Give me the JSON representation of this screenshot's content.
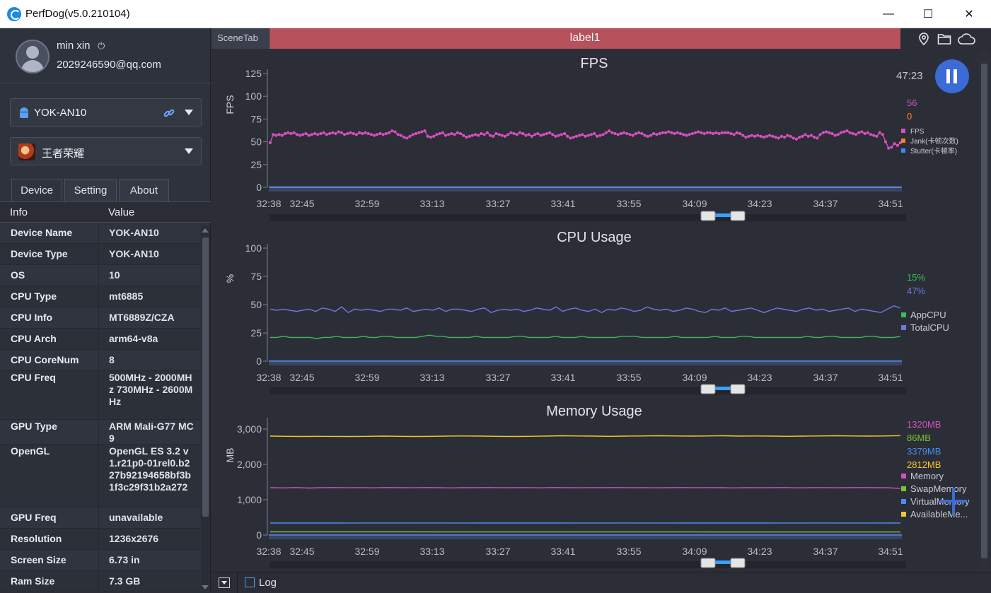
{
  "window": {
    "title": "PerfDog(v5.0.210104)",
    "minimize": "—",
    "maximize": "☐",
    "close": "✕"
  },
  "user": {
    "name": "min xin",
    "power_icon": "⏻",
    "email": "2029246590@qq.com"
  },
  "device_select": {
    "value": "YOK-AN10",
    "icon": "android-icon"
  },
  "app_select": {
    "value": "王者荣耀",
    "icon": "game-icon"
  },
  "tabs": [
    {
      "label": "Device"
    },
    {
      "label": "Setting"
    },
    {
      "label": "About"
    }
  ],
  "info_table": {
    "headers": {
      "key": "Info",
      "value": "Value"
    },
    "rows": [
      {
        "key": "Device Name",
        "value": "YOK-AN10"
      },
      {
        "key": "Device Type",
        "value": "YOK-AN10"
      },
      {
        "key": "OS",
        "value": "10"
      },
      {
        "key": "CPU Type",
        "value": "mt6885"
      },
      {
        "key": "CPU Info",
        "value": "MT6889Z/CZA"
      },
      {
        "key": "CPU Arch",
        "value": "arm64-v8a"
      },
      {
        "key": "CPU CoreNum",
        "value": "8"
      },
      {
        "key": "CPU Freq",
        "value": "500MHz - 2000MHz 730MHz - 2600MHz"
      },
      {
        "key": "GPU Type",
        "value": "ARM Mali-G77 MC9"
      },
      {
        "key": "OpenGL",
        "value": "OpenGL ES 3.2 v1.r21p0-01rel0.b227b92194658bf3b1f3c29f31b2a272"
      },
      {
        "key": "GPU Freq",
        "value": "unavailable"
      },
      {
        "key": "Resolution",
        "value": "1236x2676"
      },
      {
        "key": "Screen Size",
        "value": "6.73 in"
      },
      {
        "key": "Ram Size",
        "value": "7.3 GB"
      }
    ]
  },
  "header": {
    "scene_tab": "SceneTab",
    "label": "label1",
    "label_color": "#b5525c"
  },
  "timer": "47:23",
  "bottom": {
    "log_label": "Log"
  },
  "chart_data": [
    {
      "type": "line",
      "title": "FPS",
      "ylabel": "FPS",
      "ylim": [
        0,
        125
      ],
      "yticks": [
        "0",
        "25",
        "50",
        "75",
        "100",
        "125"
      ],
      "xticks": [
        "32:38",
        "32:45",
        "32:59",
        "33:13",
        "33:27",
        "33:41",
        "33:55",
        "34:09",
        "34:23",
        "34:37",
        "34:51"
      ],
      "current_values": [
        {
          "text": "56",
          "color": "#d64fc0"
        },
        {
          "text": "0",
          "color": "#ff7f27"
        }
      ],
      "legend": [
        {
          "name": "FPS",
          "color": "#d64fc0"
        },
        {
          "name": "Jank(卡顿次数)",
          "color": "#ff7f27"
        },
        {
          "name": "Stutter(卡顿率)",
          "color": "#3c8cf0"
        }
      ],
      "series": [
        {
          "name": "FPS",
          "color": "#d64fc0",
          "markers": true,
          "values": [
            49,
            58,
            57,
            58,
            57,
            59,
            60,
            59,
            60,
            58,
            57,
            58,
            59,
            57,
            58,
            59,
            58,
            59,
            60,
            58,
            59,
            60,
            59,
            61,
            60,
            58,
            59,
            60,
            59,
            58,
            60,
            59,
            60,
            59,
            58,
            57,
            58,
            59,
            58,
            59,
            60,
            62,
            61,
            58,
            57,
            55,
            54,
            56,
            58,
            59,
            60,
            61,
            62,
            56,
            55,
            56,
            58,
            59,
            60,
            57,
            58,
            59,
            58,
            60,
            59,
            57,
            55,
            56,
            57,
            58,
            57,
            59,
            58,
            60,
            57,
            56,
            59,
            58,
            57,
            56,
            58,
            60,
            59,
            58,
            60,
            59,
            57,
            58,
            56,
            58,
            59,
            57,
            58,
            59,
            60,
            58,
            56,
            57,
            58,
            59,
            56,
            54,
            55,
            56,
            57,
            58,
            56,
            57,
            58,
            59,
            56,
            57,
            58,
            60,
            62,
            60,
            59,
            58,
            59,
            60,
            59,
            58,
            57,
            59,
            60,
            59,
            57,
            56,
            57,
            59,
            58,
            59,
            60,
            60,
            61,
            60,
            59,
            60,
            59,
            58,
            57,
            58,
            59,
            60,
            61,
            60,
            59,
            60,
            60,
            59,
            60,
            59,
            60,
            60,
            60,
            59,
            58,
            60,
            59,
            57,
            55,
            56,
            57,
            56,
            57,
            56,
            55,
            56,
            57,
            56,
            55,
            54,
            56,
            55,
            57,
            56,
            54,
            53,
            55,
            56,
            58,
            56,
            57,
            55,
            54,
            58,
            60,
            61,
            60,
            59,
            57,
            58,
            60,
            61,
            62,
            60,
            59,
            58,
            60,
            61,
            59,
            60,
            58,
            57,
            56,
            60,
            58,
            50,
            43,
            44,
            48,
            46,
            49
          ]
        },
        {
          "name": "Jank(卡顿次数)",
          "color": "#ff7f27",
          "markers": false,
          "values": [
            0,
            0
          ]
        },
        {
          "name": "Stutter(卡顿率)",
          "color": "#3c8cf0",
          "markers": false,
          "values": [
            0,
            0
          ]
        }
      ]
    },
    {
      "type": "line",
      "title": "CPU Usage",
      "ylabel": "%",
      "ylim": [
        0,
        100
      ],
      "yticks": [
        "0",
        "25",
        "50",
        "75",
        "100"
      ],
      "xticks": [
        "32:38",
        "32:45",
        "32:59",
        "33:13",
        "33:27",
        "33:41",
        "33:55",
        "34:09",
        "34:23",
        "34:37",
        "34:51"
      ],
      "current_values": [
        {
          "text": "15%",
          "color": "#3cb95a"
        },
        {
          "text": "47%",
          "color": "#6f78e0"
        }
      ],
      "legend": [
        {
          "name": "AppCPU",
          "color": "#3cb95a"
        },
        {
          "name": "TotalCPU",
          "color": "#6f78e0"
        }
      ],
      "series": [
        {
          "name": "AppCPU",
          "color": "#3cb95a",
          "markers": false,
          "values": [
            21,
            21,
            22,
            21,
            21,
            21,
            21,
            20,
            21,
            21,
            22,
            21,
            21,
            21,
            22,
            21,
            21,
            22,
            22,
            21,
            21,
            21,
            21,
            22,
            23,
            22,
            22,
            21,
            21,
            21,
            21,
            22,
            21,
            21,
            21,
            21,
            21,
            22,
            22,
            21,
            21,
            21,
            21,
            22,
            21,
            21,
            21,
            22,
            21,
            21,
            21,
            21,
            21,
            22,
            22,
            22,
            21,
            21,
            21,
            21,
            21,
            22,
            21,
            21,
            21,
            21,
            21,
            22,
            21,
            21,
            21,
            22,
            22,
            21,
            21,
            21,
            21,
            21,
            21,
            21,
            21,
            22,
            21,
            21,
            22,
            22,
            21,
            21,
            21,
            21,
            22,
            22,
            21,
            21,
            21,
            22
          ]
        },
        {
          "name": "TotalCPU",
          "color": "#6f78e0",
          "markers": false,
          "values": [
            46,
            45,
            46,
            45,
            44,
            45,
            46,
            44,
            47,
            46,
            44,
            48,
            43,
            46,
            45,
            46,
            45,
            44,
            46,
            46,
            45,
            47,
            44,
            45,
            46,
            45,
            47,
            44,
            46,
            46,
            45,
            44,
            46,
            47,
            43,
            45,
            46,
            45,
            46,
            44,
            45,
            47,
            46,
            45,
            48,
            44,
            46,
            47,
            45,
            44,
            46,
            43,
            46,
            45,
            47,
            46,
            44,
            45,
            48,
            46,
            45,
            46,
            44,
            45,
            47,
            46,
            44,
            43,
            46,
            45,
            47,
            44,
            45,
            46,
            47,
            45,
            43,
            45,
            47,
            46,
            45,
            44,
            46,
            47,
            45,
            46,
            44,
            45,
            46,
            47,
            44,
            46,
            45,
            44,
            43,
            46,
            49,
            47
          ]
        }
      ]
    },
    {
      "type": "line",
      "title": "Memory Usage",
      "ylabel": "MB",
      "ylim": [
        0,
        3200
      ],
      "yticks": [
        "0",
        "1,000",
        "2,000",
        "3,000"
      ],
      "xticks": [
        "32:38",
        "32:45",
        "32:59",
        "33:13",
        "33:27",
        "33:41",
        "33:55",
        "34:09",
        "34:23",
        "34:37",
        "34:51"
      ],
      "current_values": [
        {
          "text": "1320MB",
          "color": "#d64fc0"
        },
        {
          "text": "86MB",
          "color": "#7cc230"
        },
        {
          "text": "3379MB",
          "color": "#4a8cf0"
        },
        {
          "text": "2812MB",
          "color": "#f4c430"
        }
      ],
      "legend": [
        {
          "name": "Memory",
          "color": "#d64fc0"
        },
        {
          "name": "SwapMemory",
          "color": "#7cc230"
        },
        {
          "name": "VirtualMemory",
          "color": "#4a8cf0"
        },
        {
          "name": "AvailableMe...",
          "color": "#f4c430"
        }
      ],
      "series": [
        {
          "name": "AvailableMemory",
          "color": "#f4c430",
          "markers": false,
          "values": [
            2800,
            2795,
            2790,
            2795,
            2792,
            2790,
            2795,
            2800,
            2795,
            2790,
            2795,
            2800,
            2805,
            2800,
            2795,
            2790,
            2795,
            2800,
            2810,
            2805,
            2800,
            2795,
            2800,
            2805,
            2810,
            2805,
            2800,
            2805,
            2810,
            2800,
            2805,
            2800,
            2795,
            2800,
            2805,
            2810,
            2805,
            2800,
            2805,
            2812
          ]
        },
        {
          "name": "Memory",
          "color": "#d64fc0",
          "markers": false,
          "values": [
            1340,
            1335,
            1345,
            1330,
            1340,
            1345,
            1338,
            1342,
            1336,
            1344,
            1340,
            1338,
            1345,
            1340,
            1335,
            1342,
            1340,
            1345,
            1338,
            1340,
            1342,
            1336,
            1344,
            1340,
            1338,
            1342,
            1340,
            1345,
            1338,
            1342,
            1336,
            1340,
            1344,
            1338,
            1342,
            1340,
            1335,
            1342,
            1338,
            1340,
            1344,
            1336,
            1340,
            1342,
            1338,
            1340,
            1344,
            1340,
            1338,
            1320
          ]
        },
        {
          "name": "VirtualMemory",
          "color": "#4a8cf0",
          "markers": false,
          "values": [
            340,
            340,
            342,
            341,
            340,
            342,
            341,
            340,
            342,
            340
          ]
        },
        {
          "name": "SwapMemory",
          "color": "#7cc230",
          "markers": false,
          "values": [
            90,
            90,
            89,
            88,
            88,
            87,
            87,
            86,
            86,
            86
          ]
        }
      ]
    }
  ]
}
